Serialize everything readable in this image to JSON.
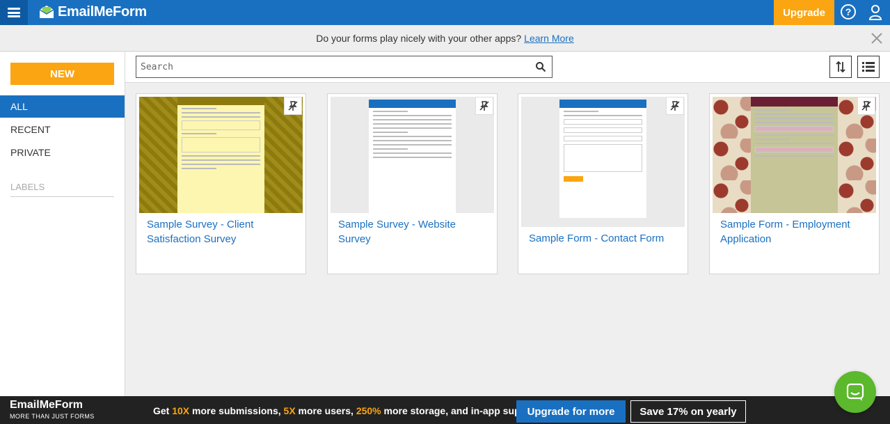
{
  "app": {
    "logo_text": "EmailMeForm",
    "upgrade_label": "Upgrade",
    "help_icon": "question-circle-icon",
    "user_icon": "user-icon"
  },
  "banner": {
    "text": "Do your forms play nicely with your other apps?",
    "link_label": "Learn More"
  },
  "sidebar": {
    "new_label": "NEW",
    "items": [
      {
        "label": "ALL",
        "active": true
      },
      {
        "label": "RECENT",
        "active": false
      },
      {
        "label": "PRIVATE",
        "active": false
      }
    ],
    "labels_header": "LABELS"
  },
  "toolbar": {
    "search_placeholder": "Search",
    "search_value": ""
  },
  "forms": [
    {
      "title": "Sample Survey - Client Satisfaction Survey",
      "thumb_title": "Sample Survey - Client Satisfaction Survey"
    },
    {
      "title": "Sample Survey - Website Survey",
      "thumb_title": "Sample Survey - Website Survey"
    },
    {
      "title": "Sample Form - Contact Form",
      "thumb_title": "Sample Form - Contact Form"
    },
    {
      "title": "Sample Form - Employment Application",
      "thumb_title": "Sample Form - Employment Application"
    }
  ],
  "bottom": {
    "logo_text": "EmailMeForm",
    "tagline": "MORE THAN JUST FORMS",
    "promo_pre": "Get ",
    "promo_hl1": "10X",
    "promo_mid1": " more submissions, ",
    "promo_hl2": "5X",
    "promo_mid2": " more users, ",
    "promo_hl3": "250%",
    "promo_post": " more storage, and in-app support.",
    "upgrade_more_label": "Upgrade for more",
    "save_yearly_label": "Save 17% on yearly"
  },
  "colors": {
    "brand_blue": "#1a70c0",
    "accent_orange": "#fba512",
    "chat_green": "#5cb82c"
  }
}
